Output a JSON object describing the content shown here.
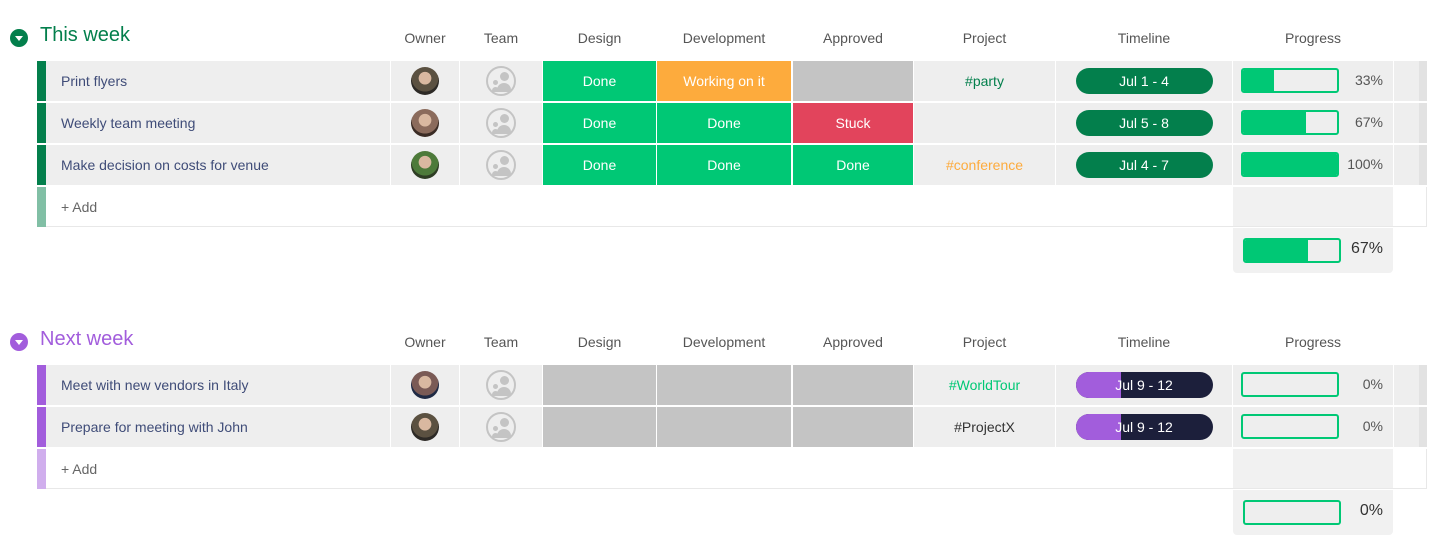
{
  "columns": [
    "Owner",
    "Team",
    "Design",
    "Development",
    "Approved",
    "Project",
    "Timeline",
    "Progress"
  ],
  "colors": {
    "done": "#00c875",
    "working": "#fdab3d",
    "stuck": "#e2445c",
    "empty": "#c4c4c4",
    "this_week": "#037f4c",
    "this_week_light": "#81bfa5",
    "next_week": "#a25ddc",
    "next_week_light": "#d0aeed",
    "timeline_dark": "#1c1f3b"
  },
  "groups": [
    {
      "title": "This week",
      "color": "#037f4c",
      "add_label": "+ Add",
      "summary_progress": 67,
      "summary_label": "67%",
      "rows": [
        {
          "name": "Print flyers",
          "design": "Done",
          "development": "Working on it",
          "approved": "",
          "project": "#party",
          "project_color": "#037f4c",
          "timeline": "Jul 1 - 4",
          "progress": 33,
          "progress_label": "33%"
        },
        {
          "name": "Weekly team meeting",
          "design": "Done",
          "development": "Done",
          "approved": "Stuck",
          "project": "",
          "project_color": "#333333",
          "timeline": "Jul 5 - 8",
          "progress": 67,
          "progress_label": "67%"
        },
        {
          "name": "Make decision on costs for venue",
          "design": "Done",
          "development": "Done",
          "approved": "Done",
          "project": "#conference",
          "project_color": "#fdab3d",
          "timeline": "Jul 4 - 7",
          "progress": 100,
          "progress_label": "100%"
        }
      ]
    },
    {
      "title": "Next week",
      "color": "#a25ddc",
      "add_label": "+ Add",
      "summary_progress": 0,
      "summary_label": "0%",
      "rows": [
        {
          "name": "Meet with new vendors in Italy",
          "design": "",
          "development": "",
          "approved": "",
          "project": "#WorldTour",
          "project_color": "#00c875",
          "timeline": "Jul 9 - 12",
          "progress": 0,
          "progress_label": "0%"
        },
        {
          "name": "Prepare for meeting with John",
          "design": "",
          "development": "",
          "approved": "",
          "project": "#ProjectX",
          "project_color": "#333333",
          "timeline": "Jul 9 - 12",
          "progress": 0,
          "progress_label": "0%"
        }
      ]
    }
  ]
}
